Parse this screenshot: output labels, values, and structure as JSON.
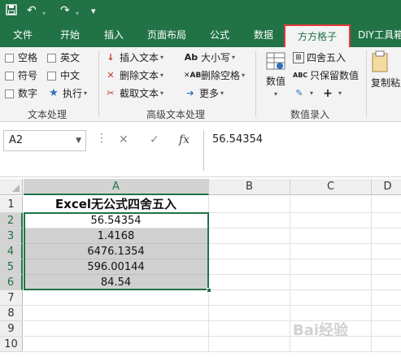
{
  "qat": {
    "save_icon": "save-icon",
    "undo_icon": "undo-icon",
    "redo_icon": "redo-icon",
    "customize_icon": "customize-icon"
  },
  "tabs": [
    {
      "label": "文件"
    },
    {
      "label": "开始"
    },
    {
      "label": "插入"
    },
    {
      "label": "页面布局"
    },
    {
      "label": "公式"
    },
    {
      "label": "数据"
    },
    {
      "label": "方方格子",
      "active": true
    },
    {
      "label": "DIY工具箱"
    }
  ],
  "ribbon": {
    "text_group": {
      "label": "文本处理",
      "checkboxes": [
        {
          "label": "空格"
        },
        {
          "label": "英文"
        },
        {
          "label": "符号"
        },
        {
          "label": "中文"
        },
        {
          "label": "数字"
        }
      ],
      "execute_label": "执行"
    },
    "adv_group": {
      "label": "高级文本处理",
      "insert_text": "插入文本",
      "delete_text": "删除文本",
      "extract_text": "截取文本",
      "case": "大小写",
      "delete_space": "删除空格",
      "more": "更多"
    },
    "num_group": {
      "label": "数值录入",
      "value_btn": "数值",
      "round": "四舍五入",
      "keep_value": "只保留数值"
    },
    "clipboard": {
      "copy_paste": "复制粘贴"
    }
  },
  "formula_bar": {
    "name_box": "A2",
    "cancel": "✕",
    "confirm": "✓",
    "fx": "fx",
    "value": "56.54354"
  },
  "grid": {
    "columns": [
      "A",
      "B",
      "C",
      "D"
    ],
    "rows": [
      "1",
      "2",
      "3",
      "4",
      "5",
      "6",
      "7",
      "8",
      "9",
      "10"
    ],
    "title": "Excel无公式四舍五入",
    "values": [
      "56.54354",
      "1.4168",
      "6476.1354",
      "596.00144",
      "84.54"
    ]
  },
  "watermark": "Bai经验"
}
